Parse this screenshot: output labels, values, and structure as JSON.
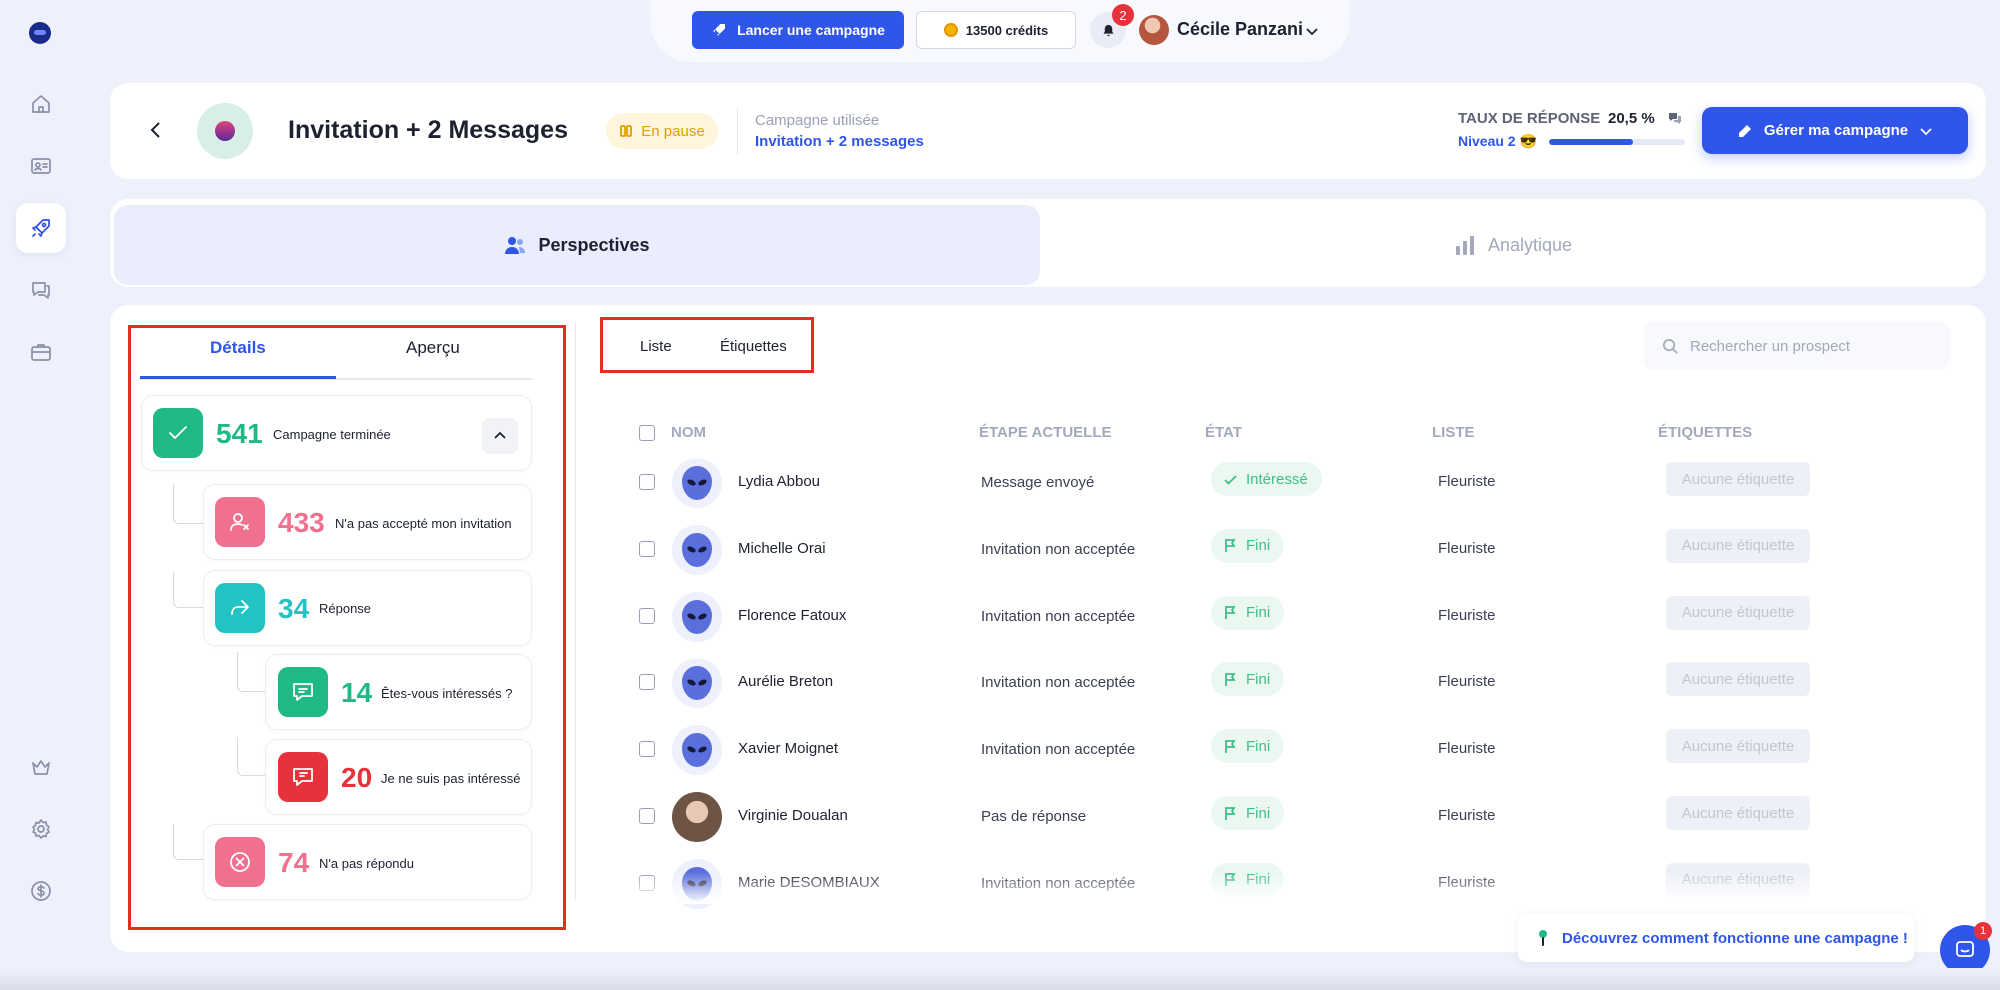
{
  "topbar": {
    "launch_label": "Lancer une campagne",
    "credits_label": "13500 crédits",
    "notification_count": "2",
    "user_name": "Cécile Panzani"
  },
  "campaign": {
    "title": "Invitation + 2 Messages",
    "status": "En pause",
    "used_label": "Campagne utilisée",
    "used_value": "Invitation + 2 messages",
    "rate_label": "TAUX DE RÉPONSE",
    "rate_value": "20,5 %",
    "level_label": "Niveau 2 😎",
    "level_progress": 0.62,
    "manage_label": "Gérer ma campagne"
  },
  "main_tabs": {
    "perspectives": "Perspectives",
    "analytique": "Analytique"
  },
  "details_panel": {
    "tab_details": "Détails",
    "tab_apercu": "Aperçu",
    "nodes": [
      {
        "count": "541",
        "label": "Campagne terminée"
      },
      {
        "count": "433",
        "label": "N'a pas accepté mon invitation"
      },
      {
        "count": "34",
        "label": "Réponse"
      },
      {
        "count": "14",
        "label": "Êtes-vous intéressés ?"
      },
      {
        "count": "20",
        "label": "Je ne suis pas intéressé"
      },
      {
        "count": "74",
        "label": "N'a pas répondu"
      }
    ],
    "colors": {
      "green": "#1fb887",
      "pink": "#f0718e",
      "teal": "#21c3c3",
      "red": "#e8323b"
    }
  },
  "list_panel": {
    "subtab_liste": "Liste",
    "subtab_etiquettes": "Étiquettes",
    "search_placeholder": "Rechercher un prospect",
    "columns": {
      "nom": "NOM",
      "etape": "ÉTAPE ACTUELLE",
      "etat": "ÉTAT",
      "liste": "LISTE",
      "etiquettes": "ÉTIQUETTES"
    },
    "rows": [
      {
        "name": "Lydia Abbou",
        "step": "Message envoyé",
        "state": "Intéressé",
        "state_icon": "check-icon",
        "list": "Fleuriste",
        "tag": "Aucune étiquette",
        "avatar": "alien"
      },
      {
        "name": "Michelle Orai",
        "step": "Invitation non acceptée",
        "state": "Fini",
        "state_icon": "flag-icon",
        "list": "Fleuriste",
        "tag": "Aucune étiquette",
        "avatar": "alien"
      },
      {
        "name": "Florence Fatoux",
        "step": "Invitation non acceptée",
        "state": "Fini",
        "state_icon": "flag-icon",
        "list": "Fleuriste",
        "tag": "Aucune étiquette",
        "avatar": "alien"
      },
      {
        "name": "Aurélie Breton",
        "step": "Invitation non acceptée",
        "state": "Fini",
        "state_icon": "flag-icon",
        "list": "Fleuriste",
        "tag": "Aucune étiquette",
        "avatar": "alien"
      },
      {
        "name": "Xavier Moignet",
        "step": "Invitation non acceptée",
        "state": "Fini",
        "state_icon": "flag-icon",
        "list": "Fleuriste",
        "tag": "Aucune étiquette",
        "avatar": "alien"
      },
      {
        "name": "Virginie Doualan",
        "step": "Pas de réponse",
        "state": "Fini",
        "state_icon": "flag-icon",
        "list": "Fleuriste",
        "tag": "Aucune étiquette",
        "avatar": "photo"
      },
      {
        "name": "Marie DESOMBIAUX",
        "step": "Invitation non acceptée",
        "state": "Fini",
        "state_icon": "flag-icon",
        "list": "Fleuriste",
        "tag": "Aucune étiquette",
        "avatar": "alien"
      }
    ]
  },
  "help": {
    "label": "Découvrez comment fonctionne une campagne !"
  },
  "chat": {
    "badge": "1"
  },
  "accent_color": "#2f56e8"
}
